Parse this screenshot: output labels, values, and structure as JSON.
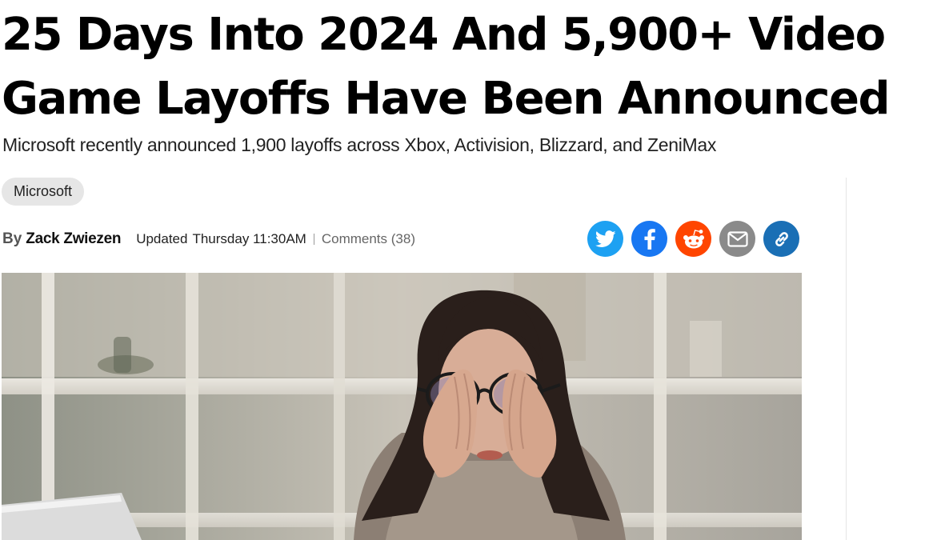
{
  "article": {
    "headline_line1": "25 Days Into 2024 And 5,900+ Video",
    "headline_line2": "Game Layoffs Have Been Announced",
    "subheadline": "Microsoft recently announced 1,900 layoffs across Xbox, Activision, Blizzard, and ZeniMax",
    "tag": "Microsoft",
    "byline_prefix": "By",
    "author": "Zack Zwiezen",
    "updated_label": "Updated",
    "updated_time": "Thursday 11:30AM",
    "comments_label": "Comments (38)"
  },
  "share": [
    {
      "icon": "twitter-icon",
      "color": "#1da1f2"
    },
    {
      "icon": "facebook-icon",
      "color": "#1877f2"
    },
    {
      "icon": "reddit-icon",
      "color": "#ff4500"
    },
    {
      "icon": "email-icon",
      "color": "#8a8a8a"
    },
    {
      "icon": "link-icon",
      "color": "#1a6fb5"
    }
  ]
}
